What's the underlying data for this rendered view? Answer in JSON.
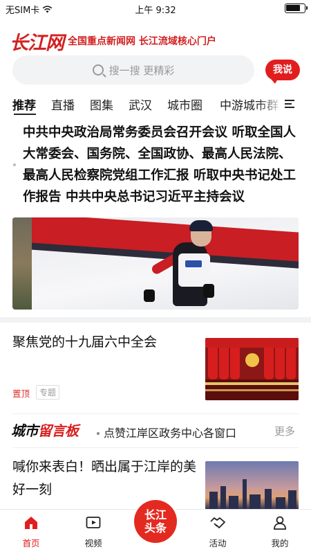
{
  "status_bar": {
    "carrier": "无SIM卡",
    "time": "上午 9:32"
  },
  "header": {
    "logo_text": "长江网",
    "slogan": "全国重点新闻网 长江流域核心门户",
    "say_button": "我说"
  },
  "search": {
    "placeholder": "搜一搜 更精彩"
  },
  "tabs": [
    {
      "label": "推荐",
      "active": true
    },
    {
      "label": "直播"
    },
    {
      "label": "图集"
    },
    {
      "label": "武汉"
    },
    {
      "label": "城市圈"
    },
    {
      "label": "中游城市群"
    }
  ],
  "top_story": {
    "headline": "中共中央政治局常务委员会召开会议 听取全国人大常委会、国务院、全国政协、最高人民法院、最高人民检察院党组工作汇报 听取中央书记处工作报告 中共中央总书记习近平主持会议"
  },
  "articles": [
    {
      "title": "聚焦党的十九届六中全会",
      "tags": [
        "置顶",
        "专题"
      ]
    },
    {
      "title": "喊你来表白！晒出属于江岸的美好一刻"
    }
  ],
  "message_board": {
    "title_black": "城市",
    "title_red": "留言板",
    "text": "点赞江岸区政务中心各窗口",
    "more": "更多"
  },
  "bottom_nav": {
    "items": [
      {
        "label": "首页",
        "active": true
      },
      {
        "label": "视频"
      },
      {
        "label": "活动"
      },
      {
        "label": "我的"
      }
    ],
    "center_label_line1": "长江",
    "center_label_line2": "头条"
  },
  "colors": {
    "brand_red": "#e21d1d",
    "text": "#222222",
    "muted": "#999999"
  }
}
